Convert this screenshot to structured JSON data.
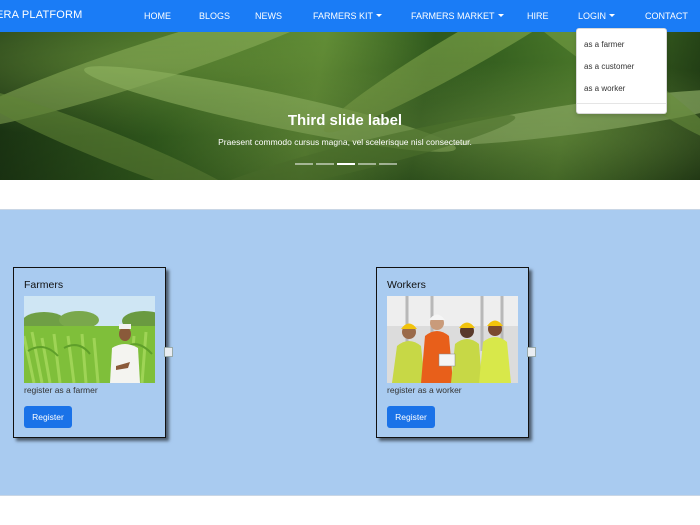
{
  "navbar": {
    "brand": "ERA PLATFORM",
    "items": [
      "HOME",
      "BLOGS",
      "NEWS",
      "FARMERS KIT",
      "FARMERS MARKET",
      "HIRE",
      "LOGIN",
      "CONTACT"
    ],
    "color": "#1a7cf6"
  },
  "login_dropdown": {
    "items": [
      "as a farmer",
      "as a customer",
      "as a worker"
    ]
  },
  "carousel": {
    "title": "Third slide label",
    "text": "Praesent commodo cursus magna, vel scelerisque nisl consectetur.",
    "active_slide": 3,
    "slide_count": 5
  },
  "cards": [
    {
      "title": "Farmers",
      "description": "register as a farmer",
      "button": "Register",
      "image": "farmer-in-field-photo"
    },
    {
      "title": "Workers",
      "description": "register as a worker",
      "button": "Register",
      "image": "workers-team-photo"
    }
  ],
  "section_color": "#a9cbf0",
  "button_color": "#1a72e8"
}
